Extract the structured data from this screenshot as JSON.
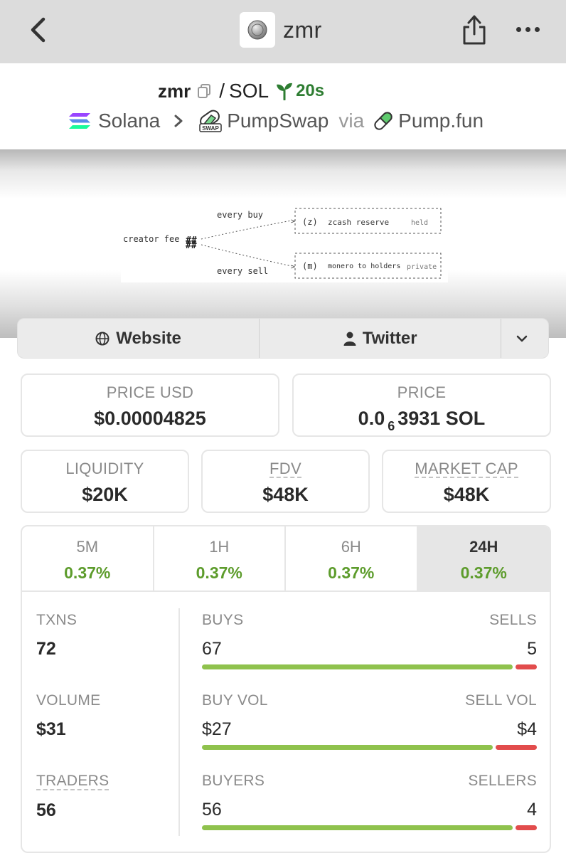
{
  "topbar": {
    "site_name": "zmr"
  },
  "pair": {
    "base": "zmr",
    "separator": "/",
    "quote": "SOL",
    "age": "20s",
    "chain": "Solana",
    "dex": "PumpSwap",
    "via": "via",
    "launchpad": "Pump.fun"
  },
  "banner": {
    "creator_fee": "creator fee",
    "every_buy": "every buy",
    "every_sell": "every sell",
    "reserve_symbol": "(z)",
    "reserve_label": "zcash reserve",
    "reserve_status": "held",
    "holders_symbol": "(m)",
    "holders_label": "monero to holders",
    "holders_status": "private"
  },
  "links": {
    "website": "Website",
    "twitter": "Twitter"
  },
  "stats": {
    "price_usd_label": "PRICE USD",
    "price_usd": "$0.00004825",
    "price_label": "PRICE",
    "price_prefix": "0.0",
    "price_sub": "6",
    "price_suffix": "3931 SOL",
    "liquidity_label": "LIQUIDITY",
    "liquidity": "$20K",
    "fdv_label": "FDV",
    "fdv": "$48K",
    "mcap_label": "MARKET CAP",
    "mcap": "$48K"
  },
  "timeframes": [
    {
      "label": "5M",
      "change": "0.37%"
    },
    {
      "label": "1H",
      "change": "0.37%"
    },
    {
      "label": "6H",
      "change": "0.37%"
    },
    {
      "label": "24H",
      "change": "0.37%"
    }
  ],
  "selected_timeframe": "24H",
  "txns": {
    "txns_label": "TXNS",
    "txns": "72",
    "buys_label": "BUYS",
    "buys": "67",
    "sells_label": "SELLS",
    "sells": "5",
    "volume_label": "VOLUME",
    "volume": "$31",
    "buy_vol_label": "BUY VOL",
    "buy_vol": "$27",
    "sell_vol_label": "SELL VOL",
    "sell_vol": "$4",
    "traders_label": "TRADERS",
    "traders": "56",
    "buyers_label": "BUYERS",
    "buyers": "56",
    "sellers_label": "SELLERS",
    "sellers": "4"
  },
  "colors": {
    "positive": "#5d9c2c",
    "buy_bar": "#8fc24d",
    "sell_bar": "#e24c4c",
    "age": "#2e7d32"
  }
}
